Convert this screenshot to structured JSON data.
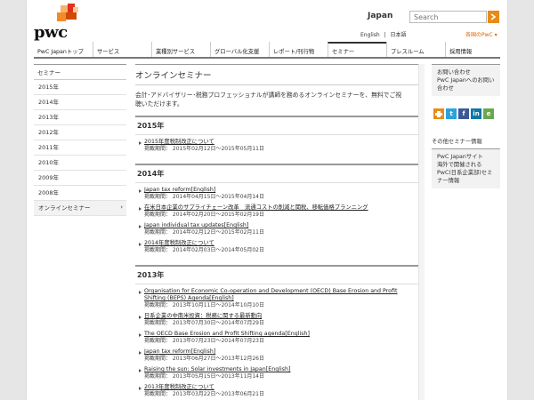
{
  "brand": {
    "wordmark": "pwc"
  },
  "header": {
    "region_title": "Japan",
    "search_placeholder": "Search",
    "lang_english": "English",
    "lang_sep": "|",
    "lang_japanese": "日本語",
    "region_link": "各国のPwC ▾"
  },
  "nav": [
    {
      "label": "PwC Japanトップ"
    },
    {
      "label": "サービス"
    },
    {
      "label": "業種別サービス"
    },
    {
      "label": "グローバル化支援"
    },
    {
      "label": "レポート/刊行物"
    },
    {
      "label": "セミナー",
      "active": true
    },
    {
      "label": "プレスルーム"
    },
    {
      "label": "採用情報"
    }
  ],
  "sidebar": {
    "heading": "セミナー",
    "items": [
      "2015年",
      "2014年",
      "2013年",
      "2012年",
      "2011年",
      "2010年",
      "2009年",
      "2008年",
      "オンラインセミナー"
    ],
    "chevron": "›"
  },
  "main": {
    "title": "オンラインセミナー",
    "lead": "会計･アドバイザリー･税務プロフェッショナルが講師を務めるオンラインセミナーを、無料でご視聴いただけます。",
    "sections": [
      {
        "year": "2015年",
        "entries": [
          {
            "title": "2015年度税制改正について",
            "period": "掲載期間： 2015年02月12日～2015年05月11日"
          }
        ]
      },
      {
        "year": "2014年",
        "entries": [
          {
            "title": "Japan tax reform[English]",
            "period": "掲載期間： 2014年04月15日～2015年04月14日"
          },
          {
            "title": "在米日本企業のサプライチェーン改革　流通コストの削減と関税、移転価格プランニング",
            "period": "掲載期間： 2014年02月20日～2015年02月19日"
          },
          {
            "title": "Japan individual tax updates[English]",
            "period": "掲載期間： 2014年02月12日～2015年02月11日"
          },
          {
            "title": "2014年度税制改正について",
            "period": "掲載期間： 2014年02月03日～2014年05月02日"
          }
        ]
      },
      {
        "year": "2013年",
        "entries": [
          {
            "title": "Organisation for Economic Co-operation and Development (OECD) Base Erosion and Profit Shifting (BEPS) Agenda[English]",
            "period": "掲載期間： 2013年10月11日～2014年10月10日"
          },
          {
            "title": "日系企業の中南米投資：税務に関する最新動向",
            "period": "掲載期間： 2013年07月30日～2014年07月29日"
          },
          {
            "title": "The OECD Base Erosion and Profit Shifting agenda[English]",
            "period": "掲載期間： 2013年07月23日～2014年07月23日"
          },
          {
            "title": "Japan tax reform[English]",
            "period": "掲載期間： 2013年06月27日～2013年12月26日"
          },
          {
            "title": "Raising the sun: Solar investments in Japan[English]",
            "period": "掲載期間： 2013年05月15日～2013年11月14日"
          },
          {
            "title": "2013年度税制改正について",
            "period": "掲載期間： 2013年03月22日～2013年06月21日"
          }
        ]
      }
    ]
  },
  "right": {
    "contact_heading": "お問い合わせ",
    "contact_link": "PwC Japanへのお問い合わせ",
    "share_icons": [
      "print-icon",
      "twitter-icon",
      "facebook-icon",
      "linkedin-icon",
      "evernote-icon"
    ],
    "other_label": "その他セミナー情報",
    "other_box_title": "PwC Japanサイト",
    "other_box_link": "海外で開催されるPwC(日系企業部)セミナー情報"
  },
  "colors": {
    "accent": "#e88b19",
    "nav_active": "#333333"
  }
}
